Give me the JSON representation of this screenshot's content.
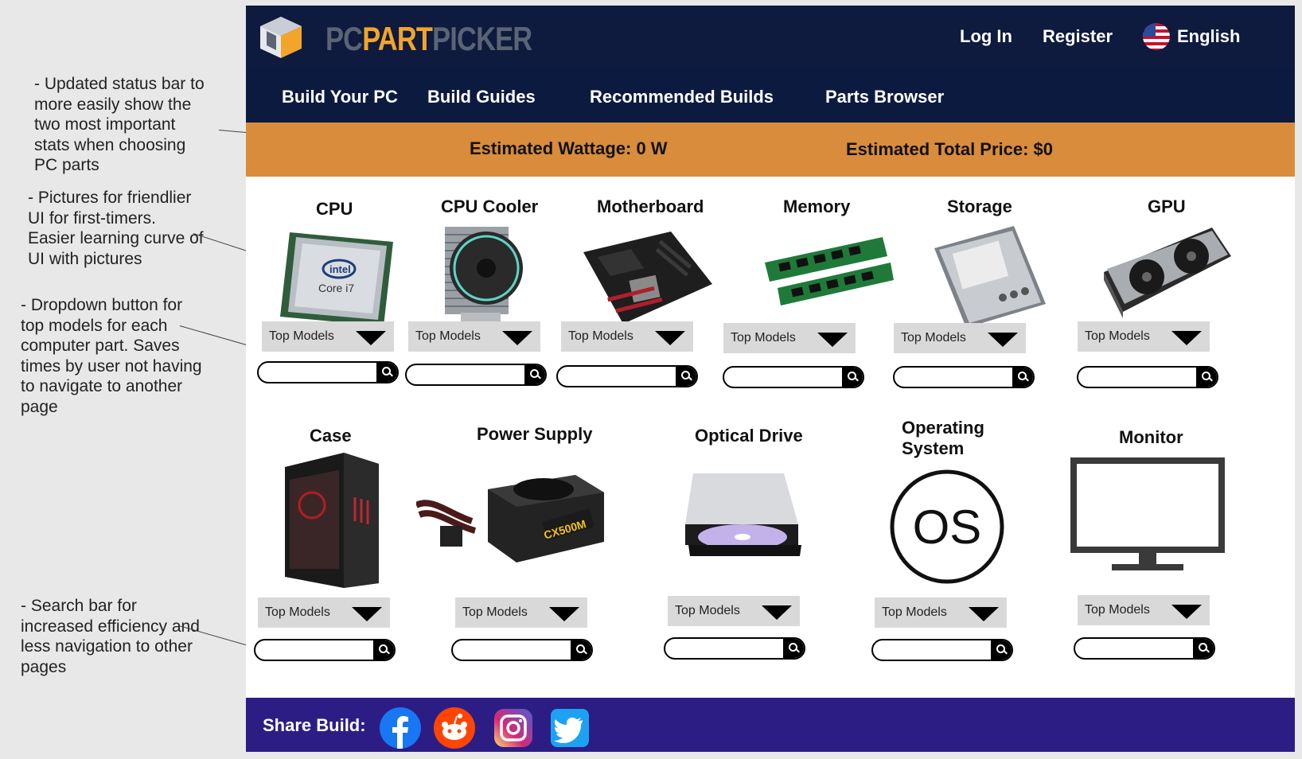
{
  "annotations": [
    "- Updated status bar to more easily show the two most important stats when choosing PC parts",
    "- Pictures for friendlier UI for first-timers. Easier learning curve of UI with pictures",
    "- Dropdown button for top models for each computer part. Saves times by user not having to navigate to another page",
    "- Search bar for increased efficiency and less navigation to other pages"
  ],
  "header": {
    "brand_pc": "PC",
    "brand_part": "PART",
    "brand_picker": "PICKER",
    "login": "Log In",
    "register": "Register",
    "language": "English"
  },
  "nav": [
    "Build Your PC",
    "Build Guides",
    "Recommended Builds",
    "Parts Browser"
  ],
  "status": {
    "wattage": "Estimated Wattage: 0 W",
    "price": "Estimated Total Price: $0"
  },
  "parts": [
    {
      "title": "CPU",
      "dropdown": "Top Models",
      "search": ""
    },
    {
      "title": "CPU Cooler",
      "dropdown": "Top Models",
      "search": ""
    },
    {
      "title": "Motherboard",
      "dropdown": "Top Models",
      "search": ""
    },
    {
      "title": "Memory",
      "dropdown": "Top Models",
      "search": ""
    },
    {
      "title": "Storage",
      "dropdown": "Top Models",
      "search": ""
    },
    {
      "title": "GPU",
      "dropdown": "Top Models",
      "search": ""
    },
    {
      "title": "Case",
      "dropdown": "Top Models",
      "search": ""
    },
    {
      "title": "Power Supply",
      "dropdown": "Top Models",
      "search": ""
    },
    {
      "title": "Optical Drive",
      "dropdown": "Top Models",
      "search": ""
    },
    {
      "title_line1": "Operating",
      "title_line2": "System",
      "dropdown": "Top Models",
      "search": ""
    },
    {
      "title": "Monitor",
      "dropdown": "Top Models",
      "search": ""
    }
  ],
  "images": {
    "cpu_brand": "intel",
    "cpu_model": "Core i7",
    "psu_model": "CX500M",
    "os_text": "OS"
  },
  "footer": {
    "share_label": "Share Build:",
    "icons": [
      "facebook-icon",
      "reddit-icon",
      "instagram-icon",
      "twitter-icon"
    ]
  },
  "colors": {
    "topbar": "#0e1a3e",
    "status": "#d98c3c",
    "footer": "#2c1d85",
    "brand_accent": "#f2a52a"
  }
}
